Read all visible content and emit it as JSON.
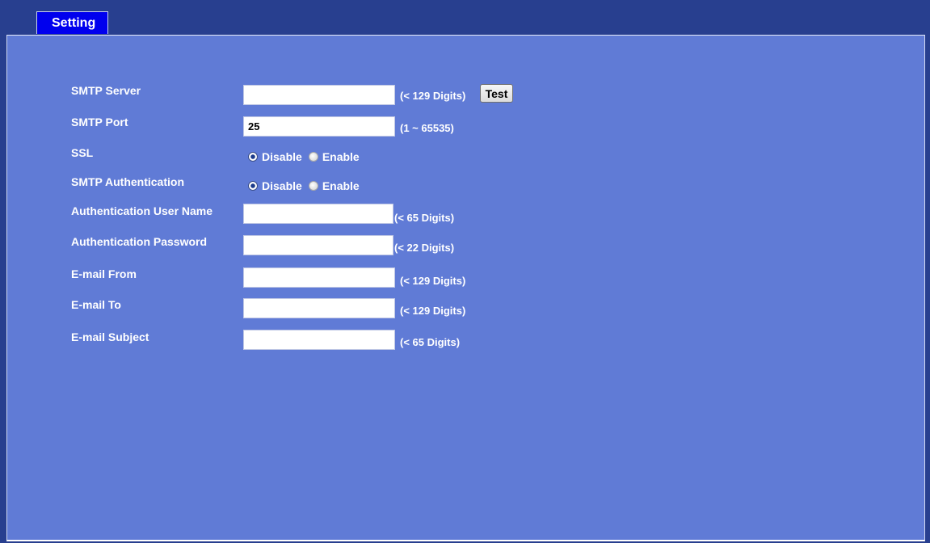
{
  "tab": {
    "label": "Setting"
  },
  "form": {
    "smtp_server": {
      "label": "SMTP Server",
      "value": "",
      "hint": "(< 129 Digits)",
      "test_label": "Test"
    },
    "smtp_port": {
      "label": "SMTP Port",
      "value": "25",
      "hint": "(1 ~ 65535)"
    },
    "ssl": {
      "label": "SSL",
      "options": [
        "Disable",
        "Enable"
      ],
      "selected": "Disable"
    },
    "smtp_auth": {
      "label": "SMTP Authentication",
      "options": [
        "Disable",
        "Enable"
      ],
      "selected": "Disable"
    },
    "auth_user": {
      "label": "Authentication User Name",
      "value": "",
      "hint": "(< 65 Digits)"
    },
    "auth_password": {
      "label": "Authentication Password",
      "value": "",
      "hint": "(< 22 Digits)"
    },
    "email_from": {
      "label": "E-mail From",
      "value": "",
      "hint": "(< 129 Digits)"
    },
    "email_to": {
      "label": "E-mail To",
      "value": "",
      "hint": "(< 129 Digits)"
    },
    "email_subject": {
      "label": "E-mail Subject",
      "value": "",
      "hint": "(< 65 Digits)"
    }
  },
  "colors": {
    "background": "#283f8f",
    "panel": "#607bd6",
    "tab": "#0000ee",
    "text": "#ffffff"
  }
}
